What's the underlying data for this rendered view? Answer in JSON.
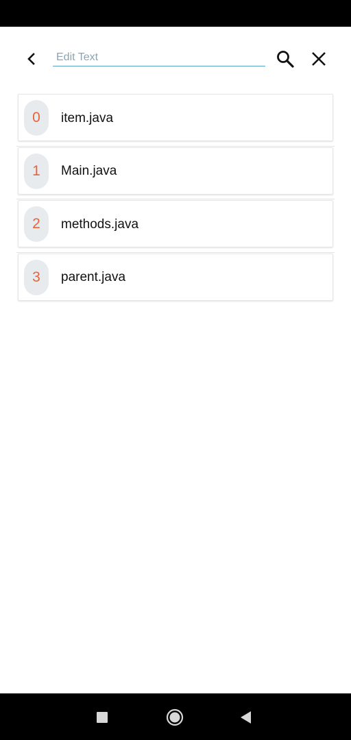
{
  "search": {
    "placeholder": "Edit Text",
    "value": ""
  },
  "icons": {
    "back": "chevron-left-icon",
    "search": "search-icon",
    "close": "close-icon",
    "recents": "square-icon",
    "home": "circle-icon",
    "nav_back": "triangle-back-icon"
  },
  "files": [
    {
      "index": "0",
      "name": "item.java"
    },
    {
      "index": "1",
      "name": "Main.java"
    },
    {
      "index": "2",
      "name": "methods.java"
    },
    {
      "index": "3",
      "name": "parent.java"
    }
  ],
  "colors": {
    "accent": "#e8623a",
    "badge_bg": "#e8ebee",
    "underline": "#5aa0c8"
  }
}
